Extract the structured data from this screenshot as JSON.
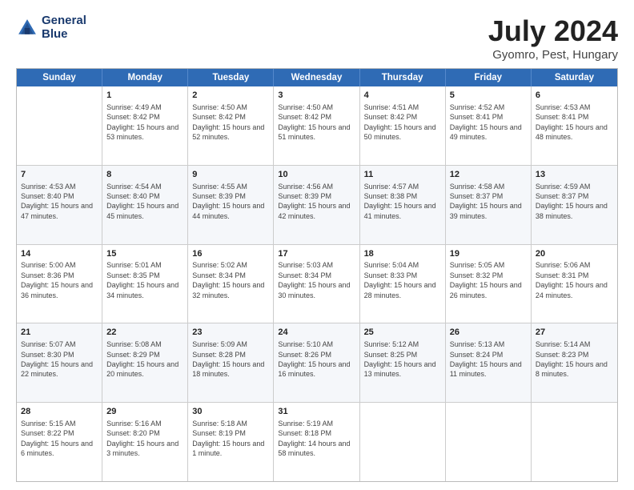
{
  "header": {
    "logo_line1": "General",
    "logo_line2": "Blue",
    "main_title": "July 2024",
    "sub_title": "Gyomro, Pest, Hungary"
  },
  "weekdays": [
    "Sunday",
    "Monday",
    "Tuesday",
    "Wednesday",
    "Thursday",
    "Friday",
    "Saturday"
  ],
  "rows": [
    [
      {
        "day": "",
        "sunrise": "",
        "sunset": "",
        "daylight": ""
      },
      {
        "day": "1",
        "sunrise": "Sunrise: 4:49 AM",
        "sunset": "Sunset: 8:42 PM",
        "daylight": "Daylight: 15 hours and 53 minutes."
      },
      {
        "day": "2",
        "sunrise": "Sunrise: 4:50 AM",
        "sunset": "Sunset: 8:42 PM",
        "daylight": "Daylight: 15 hours and 52 minutes."
      },
      {
        "day": "3",
        "sunrise": "Sunrise: 4:50 AM",
        "sunset": "Sunset: 8:42 PM",
        "daylight": "Daylight: 15 hours and 51 minutes."
      },
      {
        "day": "4",
        "sunrise": "Sunrise: 4:51 AM",
        "sunset": "Sunset: 8:42 PM",
        "daylight": "Daylight: 15 hours and 50 minutes."
      },
      {
        "day": "5",
        "sunrise": "Sunrise: 4:52 AM",
        "sunset": "Sunset: 8:41 PM",
        "daylight": "Daylight: 15 hours and 49 minutes."
      },
      {
        "day": "6",
        "sunrise": "Sunrise: 4:53 AM",
        "sunset": "Sunset: 8:41 PM",
        "daylight": "Daylight: 15 hours and 48 minutes."
      }
    ],
    [
      {
        "day": "7",
        "sunrise": "Sunrise: 4:53 AM",
        "sunset": "Sunset: 8:40 PM",
        "daylight": "Daylight: 15 hours and 47 minutes."
      },
      {
        "day": "8",
        "sunrise": "Sunrise: 4:54 AM",
        "sunset": "Sunset: 8:40 PM",
        "daylight": "Daylight: 15 hours and 45 minutes."
      },
      {
        "day": "9",
        "sunrise": "Sunrise: 4:55 AM",
        "sunset": "Sunset: 8:39 PM",
        "daylight": "Daylight: 15 hours and 44 minutes."
      },
      {
        "day": "10",
        "sunrise": "Sunrise: 4:56 AM",
        "sunset": "Sunset: 8:39 PM",
        "daylight": "Daylight: 15 hours and 42 minutes."
      },
      {
        "day": "11",
        "sunrise": "Sunrise: 4:57 AM",
        "sunset": "Sunset: 8:38 PM",
        "daylight": "Daylight: 15 hours and 41 minutes."
      },
      {
        "day": "12",
        "sunrise": "Sunrise: 4:58 AM",
        "sunset": "Sunset: 8:37 PM",
        "daylight": "Daylight: 15 hours and 39 minutes."
      },
      {
        "day": "13",
        "sunrise": "Sunrise: 4:59 AM",
        "sunset": "Sunset: 8:37 PM",
        "daylight": "Daylight: 15 hours and 38 minutes."
      }
    ],
    [
      {
        "day": "14",
        "sunrise": "Sunrise: 5:00 AM",
        "sunset": "Sunset: 8:36 PM",
        "daylight": "Daylight: 15 hours and 36 minutes."
      },
      {
        "day": "15",
        "sunrise": "Sunrise: 5:01 AM",
        "sunset": "Sunset: 8:35 PM",
        "daylight": "Daylight: 15 hours and 34 minutes."
      },
      {
        "day": "16",
        "sunrise": "Sunrise: 5:02 AM",
        "sunset": "Sunset: 8:34 PM",
        "daylight": "Daylight: 15 hours and 32 minutes."
      },
      {
        "day": "17",
        "sunrise": "Sunrise: 5:03 AM",
        "sunset": "Sunset: 8:34 PM",
        "daylight": "Daylight: 15 hours and 30 minutes."
      },
      {
        "day": "18",
        "sunrise": "Sunrise: 5:04 AM",
        "sunset": "Sunset: 8:33 PM",
        "daylight": "Daylight: 15 hours and 28 minutes."
      },
      {
        "day": "19",
        "sunrise": "Sunrise: 5:05 AM",
        "sunset": "Sunset: 8:32 PM",
        "daylight": "Daylight: 15 hours and 26 minutes."
      },
      {
        "day": "20",
        "sunrise": "Sunrise: 5:06 AM",
        "sunset": "Sunset: 8:31 PM",
        "daylight": "Daylight: 15 hours and 24 minutes."
      }
    ],
    [
      {
        "day": "21",
        "sunrise": "Sunrise: 5:07 AM",
        "sunset": "Sunset: 8:30 PM",
        "daylight": "Daylight: 15 hours and 22 minutes."
      },
      {
        "day": "22",
        "sunrise": "Sunrise: 5:08 AM",
        "sunset": "Sunset: 8:29 PM",
        "daylight": "Daylight: 15 hours and 20 minutes."
      },
      {
        "day": "23",
        "sunrise": "Sunrise: 5:09 AM",
        "sunset": "Sunset: 8:28 PM",
        "daylight": "Daylight: 15 hours and 18 minutes."
      },
      {
        "day": "24",
        "sunrise": "Sunrise: 5:10 AM",
        "sunset": "Sunset: 8:26 PM",
        "daylight": "Daylight: 15 hours and 16 minutes."
      },
      {
        "day": "25",
        "sunrise": "Sunrise: 5:12 AM",
        "sunset": "Sunset: 8:25 PM",
        "daylight": "Daylight: 15 hours and 13 minutes."
      },
      {
        "day": "26",
        "sunrise": "Sunrise: 5:13 AM",
        "sunset": "Sunset: 8:24 PM",
        "daylight": "Daylight: 15 hours and 11 minutes."
      },
      {
        "day": "27",
        "sunrise": "Sunrise: 5:14 AM",
        "sunset": "Sunset: 8:23 PM",
        "daylight": "Daylight: 15 hours and 8 minutes."
      }
    ],
    [
      {
        "day": "28",
        "sunrise": "Sunrise: 5:15 AM",
        "sunset": "Sunset: 8:22 PM",
        "daylight": "Daylight: 15 hours and 6 minutes."
      },
      {
        "day": "29",
        "sunrise": "Sunrise: 5:16 AM",
        "sunset": "Sunset: 8:20 PM",
        "daylight": "Daylight: 15 hours and 3 minutes."
      },
      {
        "day": "30",
        "sunrise": "Sunrise: 5:18 AM",
        "sunset": "Sunset: 8:19 PM",
        "daylight": "Daylight: 15 hours and 1 minute."
      },
      {
        "day": "31",
        "sunrise": "Sunrise: 5:19 AM",
        "sunset": "Sunset: 8:18 PM",
        "daylight": "Daylight: 14 hours and 58 minutes."
      },
      {
        "day": "",
        "sunrise": "",
        "sunset": "",
        "daylight": ""
      },
      {
        "day": "",
        "sunrise": "",
        "sunset": "",
        "daylight": ""
      },
      {
        "day": "",
        "sunrise": "",
        "sunset": "",
        "daylight": ""
      }
    ]
  ]
}
